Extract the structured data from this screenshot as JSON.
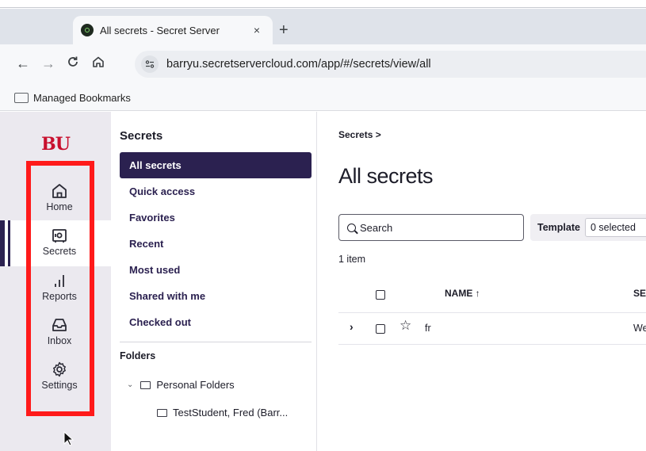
{
  "browser": {
    "tab_title": "All secrets - Secret Server",
    "tab_close": "×",
    "new_tab": "+",
    "nav": {
      "back": "←",
      "forward": "→",
      "reload": "C",
      "home": "⌂"
    },
    "url": "barryu.secretservercloud.com/app/#/secrets/view/all",
    "bookmarks_label": "Managed Bookmarks"
  },
  "rail": {
    "logo": "BU",
    "items": [
      {
        "label": "Home",
        "icon": "home-icon"
      },
      {
        "label": "Secrets",
        "icon": "secrets-icon"
      },
      {
        "label": "Reports",
        "icon": "reports-icon"
      },
      {
        "label": "Inbox",
        "icon": "inbox-icon"
      },
      {
        "label": "Settings",
        "icon": "settings-icon"
      }
    ],
    "active": "Secrets",
    "highlight_color": "#ff1a1a"
  },
  "secrets_nav": {
    "title": "Secrets",
    "items": [
      {
        "label": "All secrets",
        "active": true
      },
      {
        "label": "Quick access"
      },
      {
        "label": "Favorites"
      },
      {
        "label": "Recent"
      },
      {
        "label": "Most used"
      },
      {
        "label": "Shared with me"
      },
      {
        "label": "Checked out"
      }
    ],
    "folders_title": "Folders",
    "folders": [
      {
        "label": "Personal Folders",
        "chevron": "⌄"
      },
      {
        "label": "TestStudent, Fred (Barr..."
      }
    ]
  },
  "main": {
    "breadcrumb": "Secrets >",
    "title": "All secrets",
    "search_placeholder": "Search",
    "template_label": "Template",
    "template_value": "0 selected",
    "count": "1 item",
    "columns": {
      "name": "NAME ↑",
      "second": "SE"
    },
    "rows": [
      {
        "expand": "›",
        "star": "☆",
        "name": "fr",
        "second": "We"
      }
    ]
  },
  "colors": {
    "brand_red": "#c8102e",
    "nav_active": "#2b2150",
    "rail_bg": "#ebe9ef"
  }
}
